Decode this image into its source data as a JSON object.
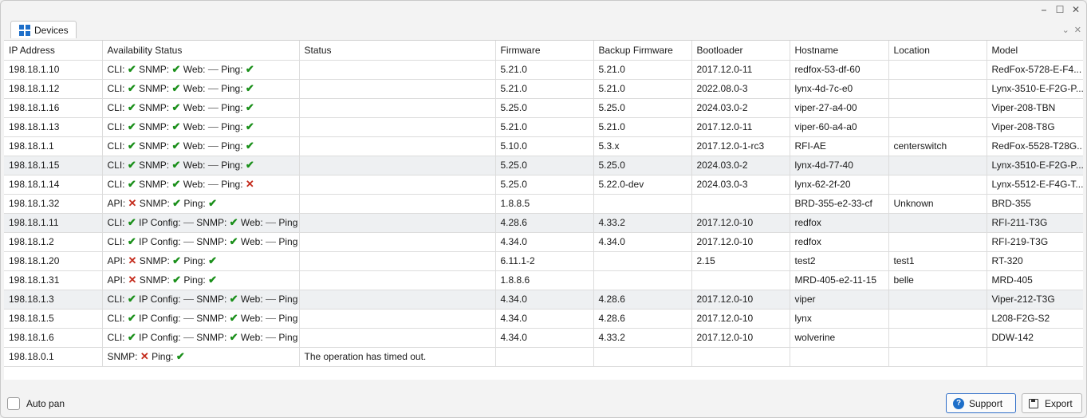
{
  "window": {
    "minimize_glyph": "⎯",
    "maximize_glyph": "☐",
    "close_glyph": "✕"
  },
  "tab": {
    "label": "Devices"
  },
  "collapse": {
    "chevron_glyph": "⌄",
    "close_glyph": "✕"
  },
  "symbols": {
    "ok": "✔",
    "bad": "✕",
    "na": "—"
  },
  "columns": [
    "IP Address",
    "Availability Status",
    "Status",
    "Firmware",
    "Backup Firmware",
    "Bootloader",
    "Hostname",
    "Location",
    "Model"
  ],
  "rows": [
    {
      "ip": "198.18.1.10",
      "avail": [
        [
          "CLI:",
          "ok"
        ],
        [
          "SNMP:",
          "ok"
        ],
        [
          "Web:",
          "na"
        ],
        [
          "Ping:",
          "ok"
        ]
      ],
      "status": "",
      "fw": "5.21.0",
      "bfw": "5.21.0",
      "boot": "2017.12.0-11",
      "host": "redfox-53-df-60",
      "loc": "",
      "model": "RedFox-5728-E-F4..."
    },
    {
      "ip": "198.18.1.12",
      "avail": [
        [
          "CLI:",
          "ok"
        ],
        [
          "SNMP:",
          "ok"
        ],
        [
          "Web:",
          "na"
        ],
        [
          "Ping:",
          "ok"
        ]
      ],
      "status": "",
      "fw": "5.21.0",
      "bfw": "5.21.0",
      "boot": "2022.08.0-3",
      "host": "lynx-4d-7c-e0",
      "loc": "",
      "model": "Lynx-3510-E-F2G-P..."
    },
    {
      "ip": "198.18.1.16",
      "avail": [
        [
          "CLI:",
          "ok"
        ],
        [
          "SNMP:",
          "ok"
        ],
        [
          "Web:",
          "na"
        ],
        [
          "Ping:",
          "ok"
        ]
      ],
      "status": "",
      "fw": "5.25.0",
      "bfw": "5.25.0",
      "boot": "2024.03.0-2",
      "host": "viper-27-a4-00",
      "loc": "",
      "model": "Viper-208-TBN"
    },
    {
      "ip": "198.18.1.13",
      "avail": [
        [
          "CLI:",
          "ok"
        ],
        [
          "SNMP:",
          "ok"
        ],
        [
          "Web:",
          "na"
        ],
        [
          "Ping:",
          "ok"
        ]
      ],
      "status": "",
      "fw": "5.21.0",
      "bfw": "5.21.0",
      "boot": "2017.12.0-11",
      "host": "viper-60-a4-a0",
      "loc": "",
      "model": "Viper-208-T8G"
    },
    {
      "ip": "198.18.1.1",
      "avail": [
        [
          "CLI:",
          "ok"
        ],
        [
          "SNMP:",
          "ok"
        ],
        [
          "Web:",
          "na"
        ],
        [
          "Ping:",
          "ok"
        ]
      ],
      "status": "",
      "fw": "5.10.0",
      "bfw": "5.3.x",
      "boot": "2017.12.0-1-rc3",
      "host": "RFI-AE",
      "loc": "centerswitch",
      "model": "RedFox-5528-T28G..."
    },
    {
      "ip": "198.18.1.15",
      "avail": [
        [
          "CLI:",
          "ok"
        ],
        [
          "SNMP:",
          "ok"
        ],
        [
          "Web:",
          "na"
        ],
        [
          "Ping:",
          "ok"
        ]
      ],
      "status": "",
      "fw": "5.25.0",
      "bfw": "5.25.0",
      "boot": "2024.03.0-2",
      "host": "lynx-4d-77-40",
      "loc": "",
      "model": "Lynx-3510-E-F2G-P..."
    },
    {
      "ip": "198.18.1.14",
      "avail": [
        [
          "CLI:",
          "ok"
        ],
        [
          "SNMP:",
          "ok"
        ],
        [
          "Web:",
          "na"
        ],
        [
          "Ping:",
          "bad"
        ]
      ],
      "status": "",
      "fw": "5.25.0",
      "bfw": "5.22.0-dev",
      "boot": "2024.03.0-3",
      "host": "lynx-62-2f-20",
      "loc": "",
      "model": "Lynx-5512-E-F4G-T..."
    },
    {
      "ip": "198.18.1.32",
      "avail": [
        [
          "API:",
          "bad"
        ],
        [
          "SNMP:",
          "ok"
        ],
        [
          "Ping:",
          "ok"
        ]
      ],
      "status": "",
      "fw": "1.8.8.5",
      "bfw": "",
      "boot": "",
      "host": "BRD-355-e2-33-cf",
      "loc": "Unknown",
      "model": "BRD-355"
    },
    {
      "ip": "198.18.1.11",
      "avail": [
        [
          "CLI:",
          "ok"
        ],
        [
          "IP Config:",
          "na"
        ],
        [
          "SNMP:",
          "ok"
        ],
        [
          "Web:",
          "na"
        ],
        [
          "Ping",
          "none"
        ]
      ],
      "status": "",
      "fw": "4.28.6",
      "bfw": "4.33.2",
      "boot": "2017.12.0-10",
      "host": "redfox",
      "loc": "",
      "model": "RFI-211-T3G"
    },
    {
      "ip": "198.18.1.2",
      "avail": [
        [
          "CLI:",
          "ok"
        ],
        [
          "IP Config:",
          "na"
        ],
        [
          "SNMP:",
          "ok"
        ],
        [
          "Web:",
          "na"
        ],
        [
          "Ping",
          "none"
        ]
      ],
      "status": "",
      "fw": "4.34.0",
      "bfw": "4.34.0",
      "boot": "2017.12.0-10",
      "host": "redfox",
      "loc": "",
      "model": "RFI-219-T3G"
    },
    {
      "ip": "198.18.1.20",
      "avail": [
        [
          "API:",
          "bad"
        ],
        [
          "SNMP:",
          "ok"
        ],
        [
          "Ping:",
          "ok"
        ]
      ],
      "status": "",
      "fw": "6.11.1-2",
      "bfw": "",
      "boot": "2.15",
      "host": "test2",
      "loc": "test1",
      "model": "RT-320"
    },
    {
      "ip": "198.18.1.31",
      "avail": [
        [
          "API:",
          "bad"
        ],
        [
          "SNMP:",
          "ok"
        ],
        [
          "Ping:",
          "ok"
        ]
      ],
      "status": "",
      "fw": "1.8.8.6",
      "bfw": "",
      "boot": "",
      "host": "MRD-405-e2-11-15",
      "loc": "belle",
      "model": "MRD-405"
    },
    {
      "ip": "198.18.1.3",
      "avail": [
        [
          "CLI:",
          "ok"
        ],
        [
          "IP Config:",
          "na"
        ],
        [
          "SNMP:",
          "ok"
        ],
        [
          "Web:",
          "na"
        ],
        [
          "Ping",
          "none"
        ]
      ],
      "status": "",
      "fw": "4.34.0",
      "bfw": "4.28.6",
      "boot": "2017.12.0-10",
      "host": "viper",
      "loc": "",
      "model": "Viper-212-T3G"
    },
    {
      "ip": "198.18.1.5",
      "avail": [
        [
          "CLI:",
          "ok"
        ],
        [
          "IP Config:",
          "na"
        ],
        [
          "SNMP:",
          "ok"
        ],
        [
          "Web:",
          "na"
        ],
        [
          "Ping",
          "none"
        ]
      ],
      "status": "",
      "fw": "4.34.0",
      "bfw": "4.28.6",
      "boot": "2017.12.0-10",
      "host": "lynx",
      "loc": "",
      "model": "L208-F2G-S2"
    },
    {
      "ip": "198.18.1.6",
      "avail": [
        [
          "CLI:",
          "ok"
        ],
        [
          "IP Config:",
          "na"
        ],
        [
          "SNMP:",
          "ok"
        ],
        [
          "Web:",
          "na"
        ],
        [
          "Ping",
          "none"
        ]
      ],
      "status": "",
      "fw": "4.34.0",
      "bfw": "4.33.2",
      "boot": "2017.12.0-10",
      "host": "wolverine",
      "loc": "",
      "model": "DDW-142"
    },
    {
      "ip": "198.18.0.1",
      "avail": [
        [
          "SNMP:",
          "bad"
        ],
        [
          "Ping:",
          "ok"
        ]
      ],
      "status": "The operation has timed out.",
      "fw": "",
      "bfw": "",
      "boot": "",
      "host": "",
      "loc": "",
      "model": ""
    }
  ],
  "alt_rows": [
    5,
    8,
    12
  ],
  "footer": {
    "autopan_label": "Auto pan",
    "support_label": "Support",
    "export_label": "Export"
  },
  "colors": {
    "ok": "#1a8f1a",
    "bad": "#c42b1c",
    "accent": "#1e6fc9"
  }
}
